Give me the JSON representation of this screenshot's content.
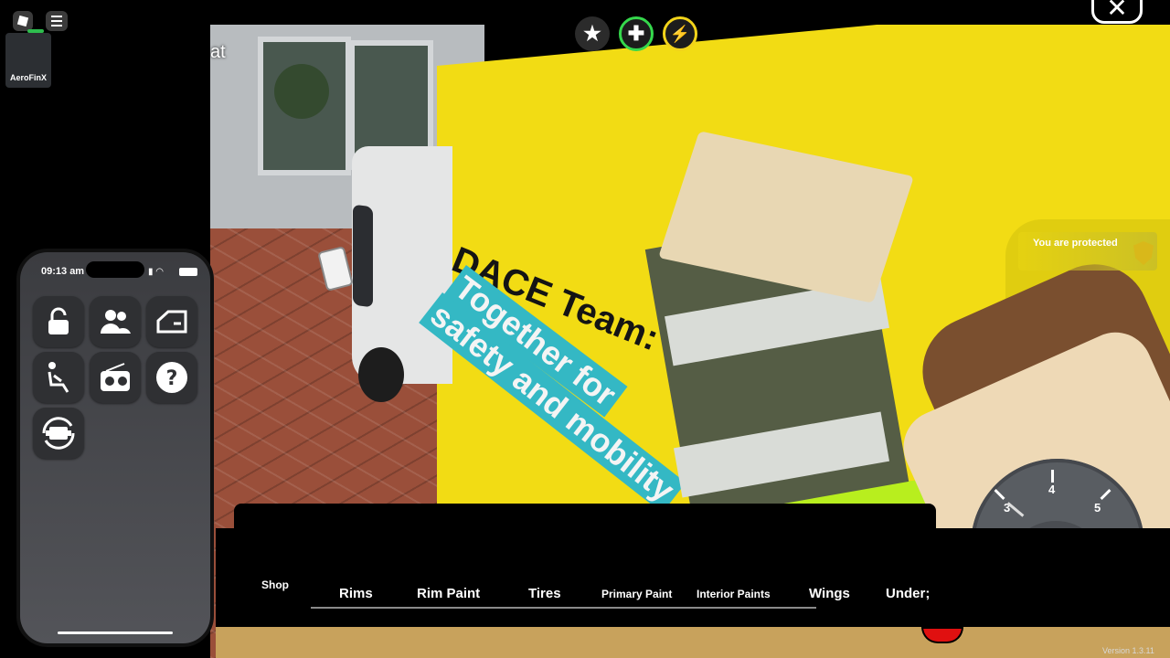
{
  "topbar": {
    "logo_icon": "roblox-logo-icon",
    "menu_icon": "hamburger-menu-icon",
    "chat_label": "Chat",
    "chat_visible_text": "at",
    "experience_tile_label": "AeroFinX",
    "favorite_icon": "star",
    "health_icon": "plus",
    "boost_icon": "lightning"
  },
  "sign": {
    "title": "DACE Team:",
    "line1": "Together for",
    "line2": "safety and mobility"
  },
  "protection": {
    "text": "You are protected"
  },
  "phone": {
    "time": "09:13 am",
    "apps": [
      {
        "name": "lock",
        "icon": "unlock-icon"
      },
      {
        "name": "passengers",
        "icon": "people-icon"
      },
      {
        "name": "doors",
        "icon": "car-door-icon"
      },
      {
        "name": "seat",
        "icon": "seat-icon"
      },
      {
        "name": "radio",
        "icon": "radio-icon"
      },
      {
        "name": "help",
        "icon": "question-icon"
      },
      {
        "name": "engine",
        "icon": "engine-icon"
      }
    ]
  },
  "speedometer": {
    "labels": [
      "3",
      "4",
      "5"
    ]
  },
  "shop": {
    "title": "Shop",
    "tabs": [
      "Rims",
      "Rim Paint",
      "Tires",
      "Primary Paint",
      "Interior Paints",
      "Wings",
      "Under;"
    ]
  },
  "footer": {
    "version": "Version 1.3.11"
  },
  "colors": {
    "panel_yellow": "#f2dc14",
    "sign_cyan": "#34b8c4",
    "plus_green": "#35d84c",
    "lightning_yellow": "#f2d41a"
  }
}
